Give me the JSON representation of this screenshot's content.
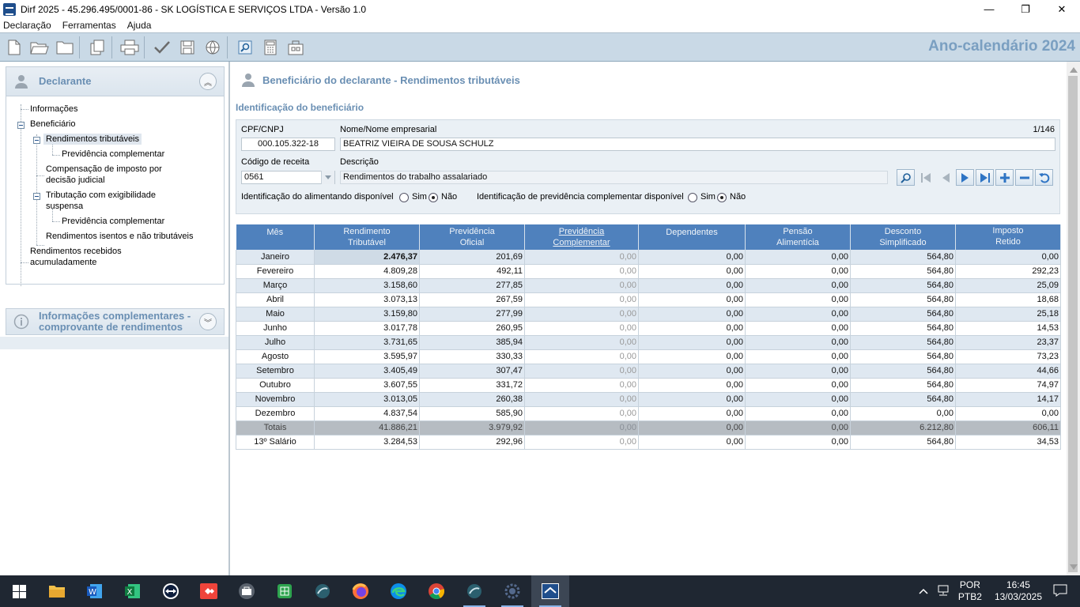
{
  "window": {
    "title": "Dirf 2025 - 45.296.495/0001-86 - SK LOGÍSTICA E SERVIÇOS LTDA - Versão 1.0",
    "minimize": "—",
    "restore": "❐",
    "close": "✕"
  },
  "menu": [
    "Declaração",
    "Ferramentas",
    "Ajuda"
  ],
  "toolbar": {
    "year_label": "Ano-calendário 2024"
  },
  "sidebar": {
    "declarante_title": "Declarante",
    "tree": {
      "informacoes": "Informações",
      "beneficiario": "Beneficiário",
      "rendimentos_tributaveis": "Rendimentos tributáveis",
      "previdencia_1": "Previdência complementar",
      "compensacao_l1": "Compensação de imposto por",
      "compensacao_l2": "decisão judicial",
      "tributacao_l1": "Tributação com exigibilidade",
      "tributacao_l2": "suspensa",
      "previdencia_2": "Previdência complementar",
      "isentos": "Rendimentos isentos e não tributáveis",
      "acumulados_l1": "Rendimentos recebidos",
      "acumulados_l2": "acumuladamente"
    },
    "info_title_l1": "Informações complementares -",
    "info_title_l2": "comprovante de rendimentos"
  },
  "main": {
    "header_title": "Beneficiário do declarante - Rendimentos tributáveis",
    "section_title": "Identificação do beneficiário",
    "cpf_label": "CPF/CNPJ",
    "cpf_value": "000.105.322-18",
    "nome_label": "Nome/Nome empresarial",
    "nome_value": "BEATRIZ VIEIRA DE SOUSA SCHULZ",
    "counter": "1/146",
    "codigo_label": "Código de receita",
    "codigo_value": "0561",
    "descricao_label": "Descrição",
    "descricao_value": "Rendimentos do trabalho assalariado",
    "alimentando_label": "Identificação do alimentando disponível",
    "previdencia_label": "Identificação de previdência complementar disponível",
    "sim": "Sim",
    "nao": "Não"
  },
  "table": {
    "headers": [
      [
        "Mês",
        ""
      ],
      [
        "Rendimento",
        "Tributável"
      ],
      [
        "Previdência",
        "Oficial"
      ],
      [
        "Previdência",
        "Complementar"
      ],
      [
        "Dependentes",
        ""
      ],
      [
        "Pensão",
        "Alimentícia"
      ],
      [
        "Desconto",
        "Simplificado"
      ],
      [
        "Imposto",
        "Retido"
      ]
    ],
    "rows": [
      [
        "Janeiro",
        "2.476,37",
        "201,69",
        "0,00",
        "0,00",
        "0,00",
        "564,80",
        "0,00"
      ],
      [
        "Fevereiro",
        "4.809,28",
        "492,11",
        "0,00",
        "0,00",
        "0,00",
        "564,80",
        "292,23"
      ],
      [
        "Março",
        "3.158,60",
        "277,85",
        "0,00",
        "0,00",
        "0,00",
        "564,80",
        "25,09"
      ],
      [
        "Abril",
        "3.073,13",
        "267,59",
        "0,00",
        "0,00",
        "0,00",
        "564,80",
        "18,68"
      ],
      [
        "Maio",
        "3.159,80",
        "277,99",
        "0,00",
        "0,00",
        "0,00",
        "564,80",
        "25,18"
      ],
      [
        "Junho",
        "3.017,78",
        "260,95",
        "0,00",
        "0,00",
        "0,00",
        "564,80",
        "14,53"
      ],
      [
        "Julho",
        "3.731,65",
        "385,94",
        "0,00",
        "0,00",
        "0,00",
        "564,80",
        "23,37"
      ],
      [
        "Agosto",
        "3.595,97",
        "330,33",
        "0,00",
        "0,00",
        "0,00",
        "564,80",
        "73,23"
      ],
      [
        "Setembro",
        "3.405,49",
        "307,47",
        "0,00",
        "0,00",
        "0,00",
        "564,80",
        "44,66"
      ],
      [
        "Outubro",
        "3.607,55",
        "331,72",
        "0,00",
        "0,00",
        "0,00",
        "564,80",
        "74,97"
      ],
      [
        "Novembro",
        "3.013,05",
        "260,38",
        "0,00",
        "0,00",
        "0,00",
        "564,80",
        "14,17"
      ],
      [
        "Dezembro",
        "4.837,54",
        "585,90",
        "0,00",
        "0,00",
        "0,00",
        "0,00",
        "0,00"
      ]
    ],
    "totals": [
      "Totais",
      "41.886,21",
      "3.979,92",
      "0,00",
      "0,00",
      "0,00",
      "6.212,80",
      "606,11"
    ],
    "salario13": [
      "13º Salário",
      "3.284,53",
      "292,96",
      "0,00",
      "0,00",
      "0,00",
      "564,80",
      "34,53"
    ]
  },
  "taskbar": {
    "lang_1": "POR",
    "lang_2": "PTB2",
    "time": "16:45",
    "date": "13/03/2025"
  },
  "colors": {
    "accent": "#6a8fb3",
    "header_blue": "#4f81bd",
    "toolbar_bg": "#c9d9e6",
    "row_alt": "#dfe8f1"
  }
}
